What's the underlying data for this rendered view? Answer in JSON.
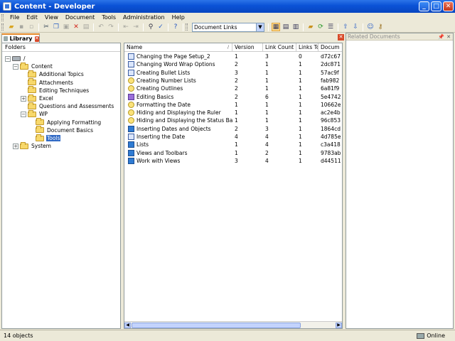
{
  "window": {
    "title": "Content - Developer",
    "minimize": "_",
    "maximize": "□",
    "close": "✕"
  },
  "menu": [
    "File",
    "Edit",
    "View",
    "Document",
    "Tools",
    "Administration",
    "Help"
  ],
  "toolbar": {
    "view_select": "Document Links",
    "dropdown_arrow": "▼"
  },
  "tab": {
    "label": "Library",
    "close": "✕"
  },
  "strip_close": "✕",
  "folders": {
    "header": "Folders",
    "tree": [
      {
        "label": "/",
        "level": 0,
        "expander": "−",
        "icon": "drive"
      },
      {
        "label": "Content",
        "level": 1,
        "expander": "−",
        "icon": "folder"
      },
      {
        "label": "Additional Topics",
        "level": 2,
        "icon": "folder"
      },
      {
        "label": "Attachments",
        "level": 2,
        "icon": "folder"
      },
      {
        "label": "Editing Techniques",
        "level": 2,
        "icon": "folder"
      },
      {
        "label": "Excel",
        "level": 2,
        "expander": "+",
        "icon": "folder"
      },
      {
        "label": "Questions and Assessments",
        "level": 2,
        "icon": "folder"
      },
      {
        "label": "WP",
        "level": 2,
        "expander": "−",
        "icon": "folder"
      },
      {
        "label": "Applying Formatting",
        "level": 3,
        "icon": "folder"
      },
      {
        "label": "Document Basics",
        "level": 3,
        "icon": "folder"
      },
      {
        "label": "Tools",
        "level": 3,
        "icon": "folder",
        "selected": true
      },
      {
        "label": "System",
        "level": 1,
        "expander": "+",
        "icon": "folder"
      }
    ]
  },
  "documents": {
    "columns": [
      "Name",
      "Version",
      "Link Count",
      "Links To",
      "Docum"
    ],
    "sort_indicator": "/",
    "rows": [
      {
        "icon": "topic",
        "name": "Changing the Page Setup_2",
        "version": "1",
        "link_count": "3",
        "links_to": "0",
        "doc": "d72c67"
      },
      {
        "icon": "topic",
        "name": "Changing Word Wrap Options",
        "version": "2",
        "link_count": "1",
        "links_to": "1",
        "doc": "2dc871"
      },
      {
        "icon": "topic",
        "name": "Creating Bullet Lists",
        "version": "3",
        "link_count": "1",
        "links_to": "1",
        "doc": "57ac9f"
      },
      {
        "icon": "question",
        "name": "Creating Number Lists",
        "version": "2",
        "link_count": "1",
        "links_to": "1",
        "doc": "fab982"
      },
      {
        "icon": "question",
        "name": "Creating Outlines",
        "version": "2",
        "link_count": "1",
        "links_to": "1",
        "doc": "6a81f9"
      },
      {
        "icon": "lesson",
        "name": "Editing Basics",
        "version": "2",
        "link_count": "6",
        "links_to": "1",
        "doc": "5e4742"
      },
      {
        "icon": "question",
        "name": "Formatting the Date",
        "version": "1",
        "link_count": "1",
        "links_to": "1",
        "doc": "10662e"
      },
      {
        "icon": "question",
        "name": "Hiding and Displaying the Ruler",
        "version": "1",
        "link_count": "1",
        "links_to": "1",
        "doc": "ac2e4b"
      },
      {
        "icon": "question",
        "name": "Hiding and Displaying the Status Bar",
        "version": "1",
        "link_count": "1",
        "links_to": "1",
        "doc": "96c853"
      },
      {
        "icon": "book",
        "name": "Inserting Dates and Objects",
        "version": "2",
        "link_count": "3",
        "links_to": "1",
        "doc": "1864cd"
      },
      {
        "icon": "topic",
        "name": "Inserting the Date",
        "version": "4",
        "link_count": "4",
        "links_to": "1",
        "doc": "4d785e"
      },
      {
        "icon": "book",
        "name": "Lists",
        "version": "1",
        "link_count": "4",
        "links_to": "1",
        "doc": "c3a418"
      },
      {
        "icon": "book",
        "name": "Views and Toolbars",
        "version": "1",
        "link_count": "2",
        "links_to": "1",
        "doc": "9783ab"
      },
      {
        "icon": "book",
        "name": "Work with Views",
        "version": "3",
        "link_count": "4",
        "links_to": "1",
        "doc": "d44511"
      }
    ],
    "scroll_left": "◀",
    "scroll_right": "▶"
  },
  "related": {
    "title": "Related Documents",
    "pin": "📌",
    "close": "✕"
  },
  "status": {
    "count": "14 objects",
    "connection": "Online"
  }
}
